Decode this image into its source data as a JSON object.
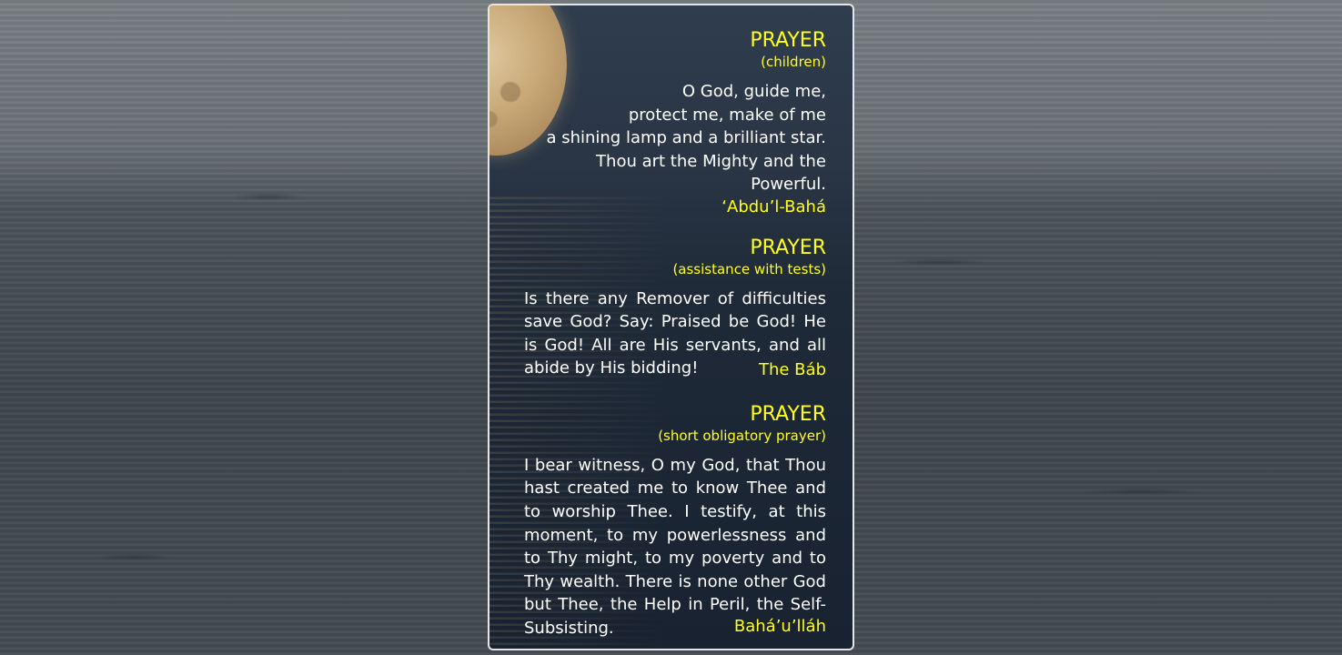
{
  "prayers": [
    {
      "title": "PRAYER",
      "subtitle": "(children)",
      "lines": [
        "O God, guide me,",
        "protect me, make of me",
        "a shining lamp and a brilliant star.",
        "Thou art the Mighty and the Powerful."
      ],
      "author": "‘Abdu’l-Bahá"
    },
    {
      "title": "PRAYER",
      "subtitle": "(assistance with tests)",
      "text": "Is there any Remover of difficulties save God? Say: Praised be God! He is God! All are His servants, and all abide by His bidding!",
      "author": "The Báb"
    },
    {
      "title": "PRAYER",
      "subtitle": "(short obligatory prayer)",
      "text": "I bear witness, O my God, that Thou hast created me to know Thee and to worship Thee. I testify, at this moment, to my powerlessness and to Thy might, to my poverty and to Thy wealth. There is none other God but Thee, the Help in Peril, the Self-Subsisting.",
      "author": "Bahá’u’lláh"
    }
  ],
  "colors": {
    "heading": "#ffff1a",
    "body_text": "#ffffff",
    "card_border": "#e6e6e6"
  }
}
